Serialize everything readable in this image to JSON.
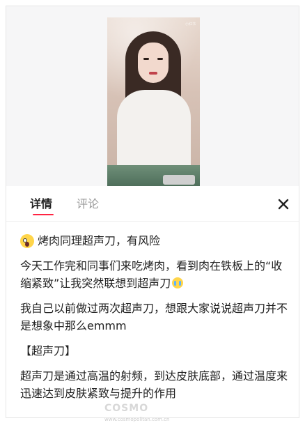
{
  "tabs": {
    "detail_label": "详情",
    "comments_label": "评论"
  },
  "close_icon": "close-icon",
  "video": {
    "watermark": "小红书"
  },
  "post": {
    "title": "烤肉同理超声刀，有风险",
    "paragraphs": [
      "今天工作完和同事们来吃烤肉，看到肉在铁板上的“收缩紧致”让我突然联想到超声刀",
      "我自己以前做过两次超声刀，想跟大家说说超声刀并不是想象中那么emmm",
      "【超声刀】",
      "超声刀是通过高温的射频，到达皮肤底部，通过温度来迅速达到皮肤紧致与提升的作用"
    ]
  },
  "watermark": {
    "brand": "COSMO",
    "url": "www.cosmopolitan.com.cn"
  },
  "colors": {
    "accent": "#ff2442",
    "text": "#222222",
    "muted": "#999999"
  }
}
